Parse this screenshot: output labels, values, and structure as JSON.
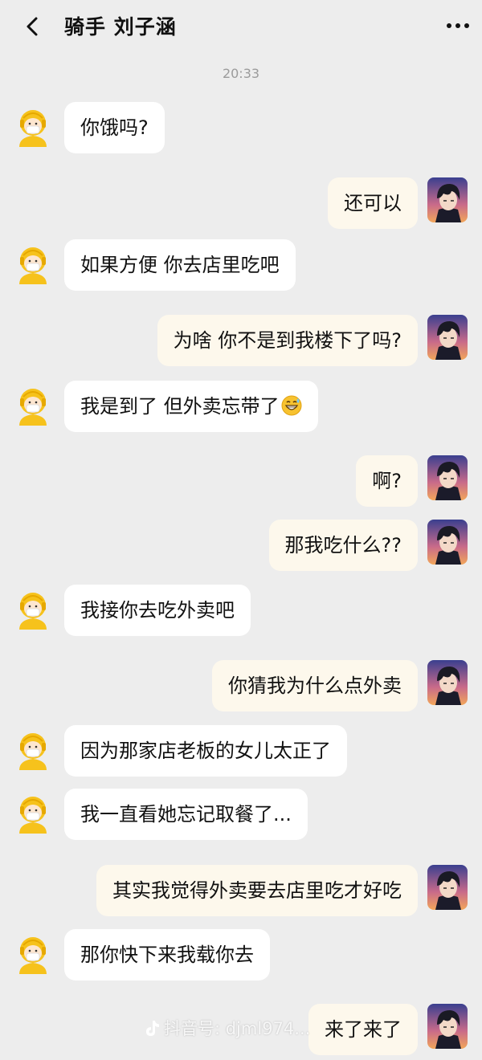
{
  "header": {
    "title": "骑手 刘子涵"
  },
  "timestamp": "20:33",
  "messages": [
    {
      "side": "left",
      "text": "你饿吗?"
    },
    {
      "side": "right",
      "text": "还可以"
    },
    {
      "side": "left",
      "text": "如果方便 你去店里吃吧"
    },
    {
      "side": "right",
      "text": "为啥 你不是到我楼下了吗?"
    },
    {
      "side": "left",
      "text": "我是到了 但外卖忘带了",
      "emoji": "grin-sweat-emoji"
    },
    {
      "side": "right",
      "text": "啊?"
    },
    {
      "side": "right",
      "text": "那我吃什么??"
    },
    {
      "side": "left",
      "text": "我接你去吃外卖吧"
    },
    {
      "side": "right",
      "text": "你猜我为什么点外卖"
    },
    {
      "side": "left",
      "text": "因为那家店老板的女儿太正了"
    },
    {
      "side": "left",
      "text": "我一直看她忘记取餐了..."
    },
    {
      "side": "right",
      "text": "其实我觉得外卖要去店里吃才好吃"
    },
    {
      "side": "left",
      "text": "那你快下来我载你去"
    },
    {
      "side": "right",
      "text": "来了来了"
    }
  ],
  "watermark": "抖音号: djml974..."
}
